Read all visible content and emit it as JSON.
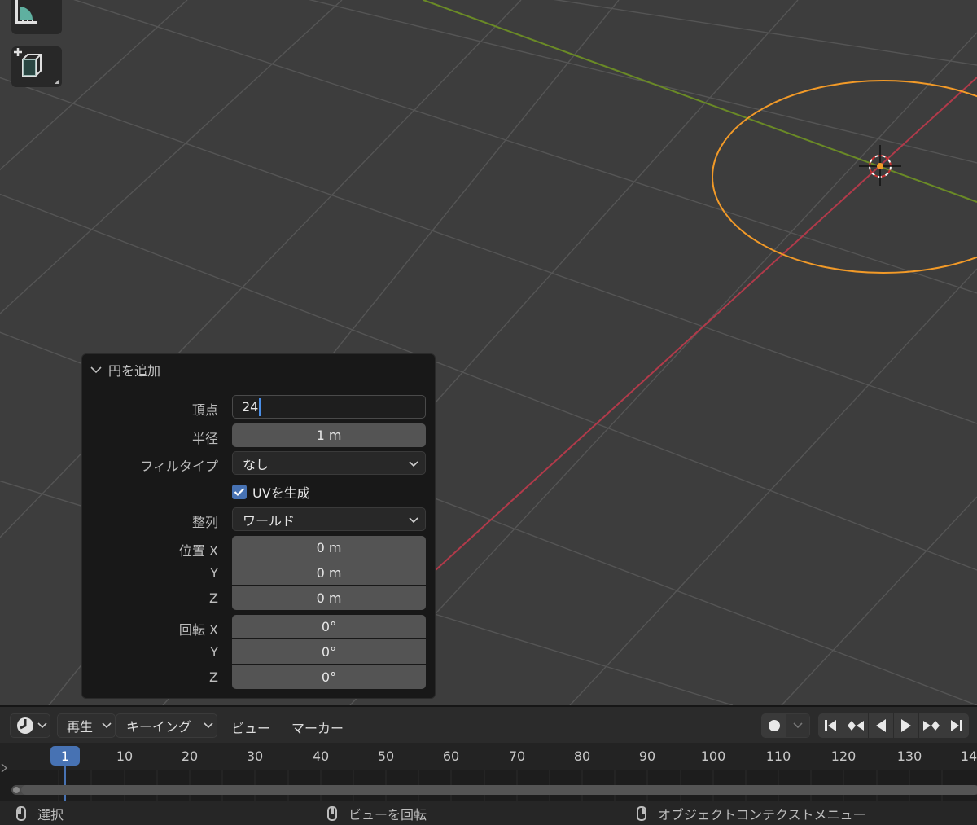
{
  "operator_panel": {
    "title": "円を追加",
    "vertices": {
      "label": "頂点",
      "value": "24"
    },
    "radius": {
      "label": "半径",
      "value": "1 m"
    },
    "fill_type": {
      "label": "フィルタイプ",
      "value": "なし"
    },
    "generate_uv": {
      "label": "UVを生成",
      "checked": true
    },
    "align": {
      "label": "整列",
      "value": "ワールド"
    },
    "location": {
      "label": "位置",
      "x_label": "X",
      "y_label": "Y",
      "z_label": "Z",
      "x": "0 m",
      "y": "0 m",
      "z": "0 m"
    },
    "rotation": {
      "label": "回転",
      "x_label": "X",
      "y_label": "Y",
      "z_label": "Z",
      "x": "0°",
      "y": "0°",
      "z": "0°"
    }
  },
  "timeline": {
    "playback_menu": "再生",
    "keying_menu": "キーイング",
    "view_menu": "ビュー",
    "marker_menu": "マーカー",
    "current_frame": "1",
    "ticks": [
      "10",
      "20",
      "30",
      "40",
      "50",
      "60",
      "70",
      "80",
      "90",
      "100",
      "110",
      "120",
      "130",
      "14"
    ]
  },
  "statusbar": {
    "left": "選択",
    "middle": "ビューを回転",
    "right": "オブジェクトコンテクストメニュー"
  },
  "colors": {
    "x_axis": "#b13a4a",
    "y_axis": "#6a8a26",
    "selected_object": "#f29a28",
    "accent": "#4772b3"
  },
  "icons": [
    "measure-icon",
    "add-cube-icon",
    "clock-icon",
    "record-icon",
    "jump-start-icon",
    "prev-keyframe-icon",
    "play-reverse-icon",
    "play-icon",
    "next-keyframe-icon",
    "jump-end-icon",
    "mouse-left-icon",
    "mouse-middle-icon",
    "mouse-right-icon"
  ]
}
